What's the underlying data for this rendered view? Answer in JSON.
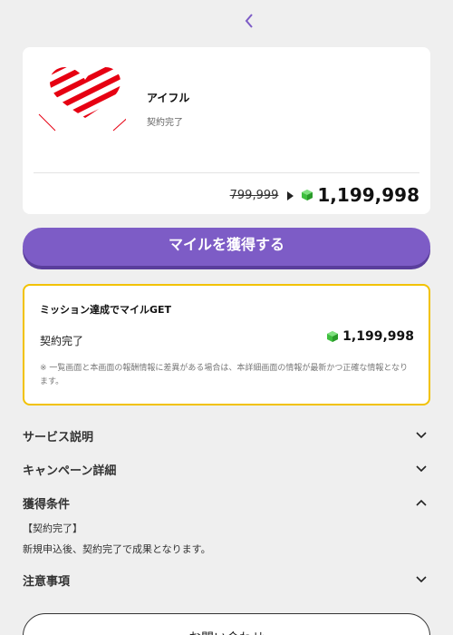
{
  "nav": {
    "back_icon": "chevron-left-icon"
  },
  "offer": {
    "company": "アイフル",
    "status": "契約完了",
    "old_price": "799,999",
    "new_price": "1,199,998",
    "gem_icon": "green-gem-icon"
  },
  "cta": {
    "label": "マイルを獲得する"
  },
  "mission": {
    "title": "ミッション達成でマイルGET",
    "row_label": "契約完了",
    "row_value": "1,199,998",
    "note": "※ 一覧画面と本画面の報酬情報に差異がある場合は、本詳細画面の情報が最新かつ正確な情報となります。"
  },
  "sections": {
    "service": "サービス説明",
    "campaign": "キャンペーン詳細",
    "conditions": "獲得条件",
    "notes": "注意事項"
  },
  "conditions": {
    "line1": "【契約完了】",
    "line2": "新規申込後、契約完了で成果となります。"
  },
  "contact": {
    "label": "お問い合わせ"
  },
  "colors": {
    "accent": "#7d5cc6",
    "highlight_border": "#f2c200",
    "logo_red": "#e60012",
    "gem": "#3fbf3f"
  }
}
